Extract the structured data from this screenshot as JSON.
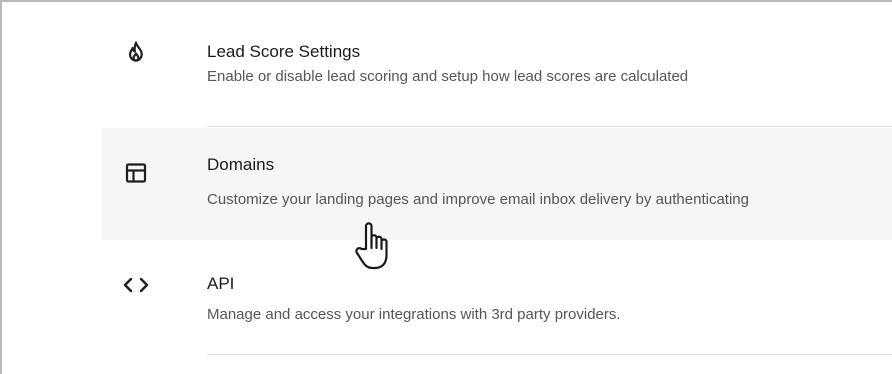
{
  "settings": {
    "items": [
      {
        "title": "Lead Score Settings",
        "description": "Enable or disable lead scoring and setup how lead scores are calculated",
        "icon": "flame-icon"
      },
      {
        "title": "Domains",
        "description": "Customize your landing pages and improve email inbox delivery by authenticating",
        "icon": "layout-icon",
        "hovered": true
      },
      {
        "title": "API",
        "description": "Manage and access your integrations with 3rd party providers.",
        "icon": "code-icon"
      }
    ]
  },
  "colors": {
    "hover_background": "#f6f6f6",
    "divider": "#e2e2e2",
    "title_text": "#1a1a1a",
    "description_text": "#555555"
  }
}
